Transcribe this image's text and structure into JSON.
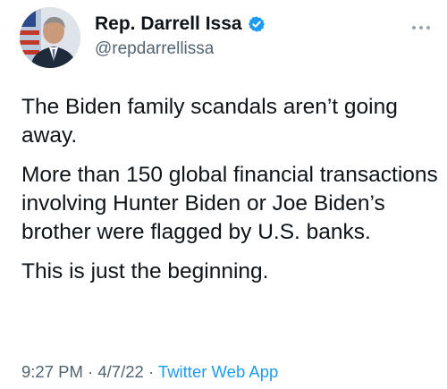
{
  "author": {
    "name": "Rep. Darrell Issa",
    "handle": "@repdarrellissa",
    "verified": true,
    "verified_color": "#1d9bf0"
  },
  "more_icon": "ellipsis-icon",
  "tweet": {
    "paragraphs": [
      "The Biden family scandals aren’t going away.",
      "More than 150 global financial transactions involving Hunter Biden or Joe Biden’s brother were flagged by U.S. banks.",
      "This is just the beginning."
    ],
    "time": "9:27 PM",
    "date": "4/7/22",
    "separator": "·",
    "source": "Twitter Web App"
  },
  "colors": {
    "text": "#0f1419",
    "muted": "#536471",
    "link": "#1d9bf0"
  }
}
